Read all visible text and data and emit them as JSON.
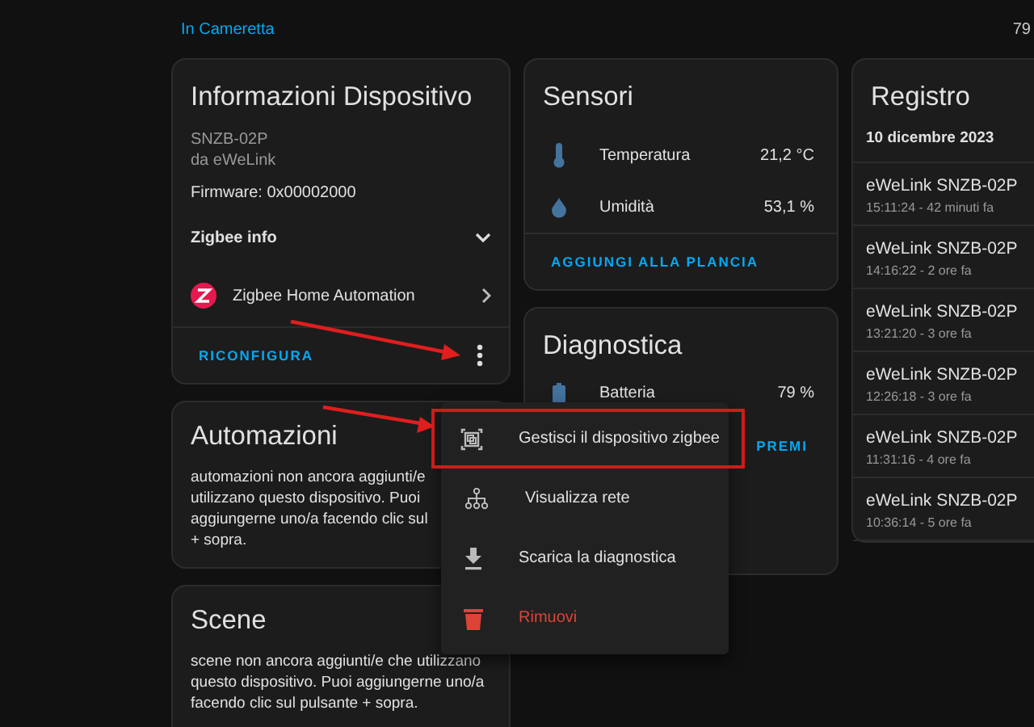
{
  "header": {
    "breadcrumb": "In Cameretta",
    "right_text": "79"
  },
  "device_info": {
    "title": "Informazioni Dispositivo",
    "model": "SNZB-02P",
    "manufacturer": "da eWeLink",
    "firmware": "Firmware: 0x00002000",
    "zigbee_info": {
      "label": "Zigbee info",
      "expanded": false
    },
    "integration": "Zigbee Home Automation",
    "action": "RICONFIGURA"
  },
  "automations": {
    "title": "Automazioni",
    "lines": [
      "automazioni non ancora aggiunti/e",
      "utilizzano questo dispositivo. Puoi",
      "aggiungerne uno/a facendo clic sul",
      "+ sopra."
    ]
  },
  "scenes": {
    "title": "Scene",
    "lines": [
      "scene non ancora aggiunti/e che utilizzano",
      "questo dispositivo. Puoi aggiungerne uno/a",
      "facendo clic sul pulsante + sopra."
    ]
  },
  "sensors": {
    "title": "Sensori",
    "rows": [
      {
        "kind": "thermometer",
        "name": "Temperatura",
        "value": "21,2 °C"
      },
      {
        "kind": "humidity",
        "name": "Umidità",
        "value": "53,1 %"
      }
    ],
    "action": "AGGIUNGI ALLA PLANCIA"
  },
  "diagnostics": {
    "title": "Diagnostica",
    "rows": [
      {
        "kind": "battery",
        "name": "Batteria",
        "value": "79 %"
      }
    ],
    "button": "PREMI"
  },
  "logbook": {
    "title": "Registro",
    "date": "10 dicembre 2023",
    "entries": [
      {
        "title": "eWeLink SNZB-02P",
        "time": "15:11:24 - 42 minuti fa"
      },
      {
        "title": "eWeLink SNZB-02P",
        "time": "14:16:22 - 2 ore fa"
      },
      {
        "title": "eWeLink SNZB-02P",
        "time": "13:21:20 - 3 ore fa"
      },
      {
        "title": "eWeLink SNZB-02P",
        "time": "12:26:18 - 3 ore fa"
      },
      {
        "title": "eWeLink SNZB-02P",
        "time": "11:31:16 - 4 ore fa"
      },
      {
        "title": "eWeLink SNZB-02P",
        "time": "10:36:14 - 5 ore fa"
      }
    ]
  },
  "menu": {
    "items": [
      {
        "kind": "manage",
        "label": "Gestisci il dispositivo zigbee",
        "highlighted": true
      },
      {
        "kind": "network",
        "label": "Visualizza rete",
        "highlighted": false
      },
      {
        "kind": "download",
        "label": "Scarica la diagnostica",
        "highlighted": false
      },
      {
        "kind": "delete",
        "label": "Rimuovi",
        "highlighted": false
      }
    ]
  }
}
